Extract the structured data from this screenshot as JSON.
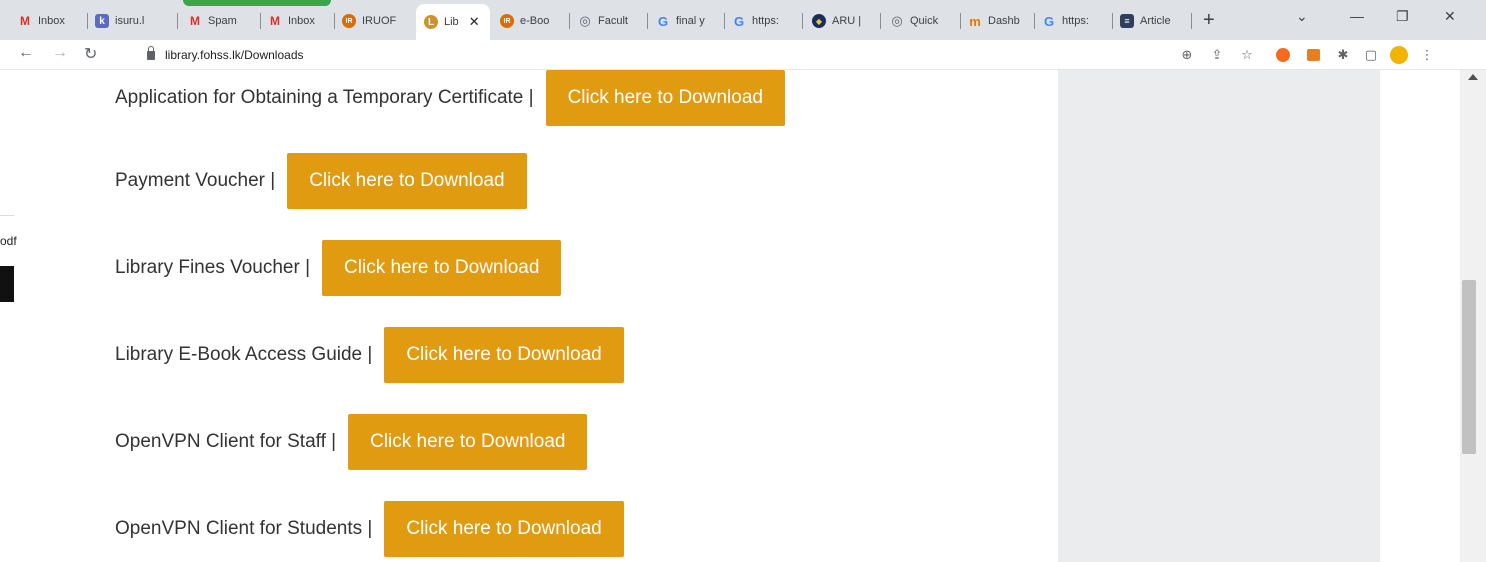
{
  "browser": {
    "tabs": [
      {
        "label": "Inbox",
        "icon": "gmail-icon",
        "color": "#d93025",
        "glyph": "M"
      },
      {
        "label": "isuru.l",
        "icon": "k-icon",
        "color": "#5c6bc0",
        "glyph": "k"
      },
      {
        "label": "Spam",
        "icon": "gmail-icon",
        "color": "#d93025",
        "glyph": "M"
      },
      {
        "label": "Inbox",
        "icon": "gmail-icon",
        "color": "#d93025",
        "glyph": "M"
      },
      {
        "label": "IRUOF",
        "icon": "ir-icon",
        "color": "#e06a00",
        "glyph": "IR"
      },
      {
        "label": "Lib",
        "icon": "library-icon",
        "color": "#d0902a",
        "glyph": "L",
        "active": true
      },
      {
        "label": "e-Boo",
        "icon": "ir-icon",
        "color": "#e06a00",
        "glyph": "IR"
      },
      {
        "label": "Facult",
        "icon": "globe-icon",
        "color": "#5f6368",
        "glyph": "◎"
      },
      {
        "label": "final y",
        "icon": "google-icon",
        "color": "#4285f4",
        "glyph": "G"
      },
      {
        "label": "https:",
        "icon": "google-icon",
        "color": "#4285f4",
        "glyph": "G"
      },
      {
        "label": "ARU |",
        "icon": "aru-icon",
        "color": "#1a2e5a",
        "glyph": "◆"
      },
      {
        "label": "Quick",
        "icon": "globe-icon",
        "color": "#5f6368",
        "glyph": "◎"
      },
      {
        "label": "Dashb",
        "icon": "m-icon",
        "color": "#e07b00",
        "glyph": "m"
      },
      {
        "label": "https:",
        "icon": "google-icon",
        "color": "#4285f4",
        "glyph": "G"
      },
      {
        "label": "Article",
        "icon": "article-icon",
        "color": "#2f3e5c",
        "glyph": "≡"
      }
    ],
    "url": "library.fohss.lk/Downloads"
  },
  "side": {
    "text": "odf"
  },
  "downloads": {
    "button_label": "Click here to Download",
    "items": [
      {
        "label": "Application for Obtaining a Temporary Certificate |"
      },
      {
        "label": "Payment Voucher |"
      },
      {
        "label": "Library Fines Voucher |"
      },
      {
        "label": "Library E-Book Access Guide |"
      },
      {
        "label": "OpenVPN Client for Staff |"
      },
      {
        "label": "OpenVPN Client for Students |"
      }
    ]
  },
  "colors": {
    "button": "#e09b11",
    "panel": "#ebecee"
  }
}
